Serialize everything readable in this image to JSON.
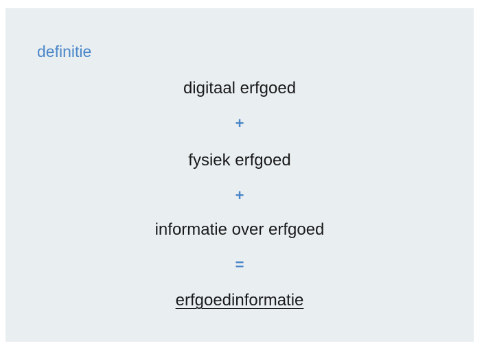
{
  "definition": {
    "label": "definitie",
    "terms": [
      "digitaal erfgoed",
      "fysiek erfgoed",
      "informatie over erfgoed"
    ],
    "operators": [
      "+",
      "+",
      "="
    ],
    "result": "erfgoedinformatie"
  },
  "colors": {
    "background": "#e9eef1",
    "accent": "#4a86c8",
    "text": "#1a1a1a"
  }
}
